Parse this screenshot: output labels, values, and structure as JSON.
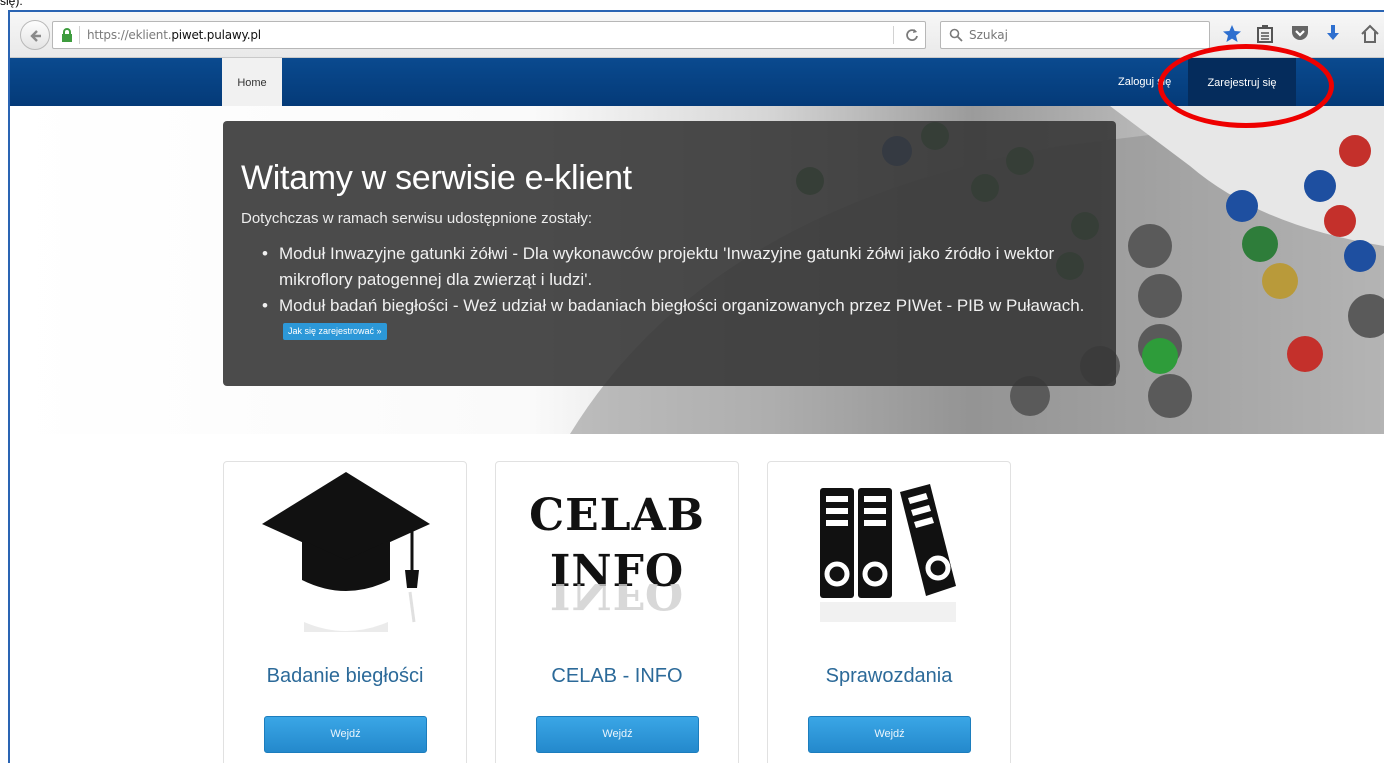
{
  "window": {
    "caption": "się)."
  },
  "toolbar": {
    "url_prefix": "https://eklient.",
    "url_domain": "piwet.pulawy.pl",
    "search_placeholder": "Szukaj",
    "icons": [
      "back-icon",
      "lock-icon",
      "reload-icon",
      "search-icon",
      "star-icon",
      "reading-list-icon",
      "pocket-icon",
      "download-icon",
      "home-icon"
    ]
  },
  "nav": {
    "home": "Home",
    "login": "Zaloguj się",
    "register": "Zarejestruj się",
    "highlight_color": "#ee0000"
  },
  "hero": {
    "title": "Witamy w serwisie e-klient",
    "intro": "Dotychczas w ramach serwisu udostępnione zostały:",
    "items": [
      "Moduł Inwazyjne gatunki żółwi - Dla wykonawców projektu 'Inwazyjne gatunki żółwi jako źródło i wektor mikroflory patogennej dla zwierząt i ludzi'.",
      "Moduł badań biegłości - Weź udział w badaniach biegłości organizowanych przez PIWet - PIB w Puławach."
    ],
    "register_button": "Jak się zarejestrować »"
  },
  "cards": [
    {
      "title": "Badanie biegłości",
      "button": "Wejdź",
      "icon": "graduation-cap-icon"
    },
    {
      "title": "CELAB - INFO",
      "button": "Wejdź",
      "logo_line1": "CELAB",
      "logo_line2": "INFO"
    },
    {
      "title": "Sprawozdania",
      "button": "Wejdź",
      "icon": "binders-icon"
    }
  ]
}
